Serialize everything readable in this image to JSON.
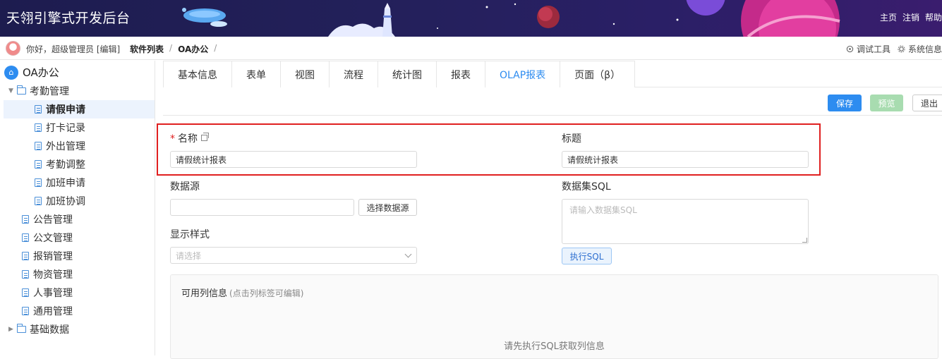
{
  "header": {
    "title": "天翎引擎式开发后台",
    "nav": [
      "主页",
      "注销",
      "帮助"
    ]
  },
  "crumbbar": {
    "greeting": "你好，超级管理员 [编辑]",
    "crumbs": [
      "软件列表",
      "OA办公"
    ],
    "separator": "/",
    "tools": [
      "调试工具",
      "系统信息"
    ]
  },
  "sidebar": {
    "root": "OA办公",
    "items": [
      {
        "label": "考勤管理",
        "type": "folder",
        "expanded": true
      },
      {
        "label": "请假申请",
        "type": "doc",
        "selected": true
      },
      {
        "label": "打卡记录",
        "type": "doc"
      },
      {
        "label": "外出管理",
        "type": "doc"
      },
      {
        "label": "考勤调整",
        "type": "doc"
      },
      {
        "label": "加班申请",
        "type": "doc"
      },
      {
        "label": "加班协调",
        "type": "doc"
      },
      {
        "label": "公告管理",
        "type": "doc"
      },
      {
        "label": "公文管理",
        "type": "doc"
      },
      {
        "label": "报销管理",
        "type": "doc"
      },
      {
        "label": "物资管理",
        "type": "doc"
      },
      {
        "label": "人事管理",
        "type": "doc"
      },
      {
        "label": "通用管理",
        "type": "doc"
      },
      {
        "label": "基础数据",
        "type": "folder",
        "expanded": false
      }
    ]
  },
  "tabs": [
    "基本信息",
    "表单",
    "视图",
    "流程",
    "统计图",
    "报表",
    "OLAP报表",
    "页面（β）"
  ],
  "active_tab": "OLAP报表",
  "actions": {
    "save": "保存",
    "preview": "预览",
    "exit": "退出"
  },
  "form": {
    "name_label": "名称",
    "name_value": "请假统计报表",
    "title_label": "标题",
    "title_value": "请假统计报表",
    "datasource_label": "数据源",
    "datasource_value": "",
    "select_datasource_button": "选择数据源",
    "style_label": "显示样式",
    "style_placeholder": "请选择",
    "sql_label": "数据集SQL",
    "sql_placeholder": "请输入数据集SQL",
    "run_sql_button": "执行SQL"
  },
  "columns_panel": {
    "title": "可用列信息",
    "hint": "(点击列标签可编辑)",
    "empty_text": "请先执行SQL获取列信息"
  },
  "colors": {
    "accent": "#2d8cf0",
    "highlight_border": "#e02020",
    "preview_disabled": "#a8dcb0"
  }
}
